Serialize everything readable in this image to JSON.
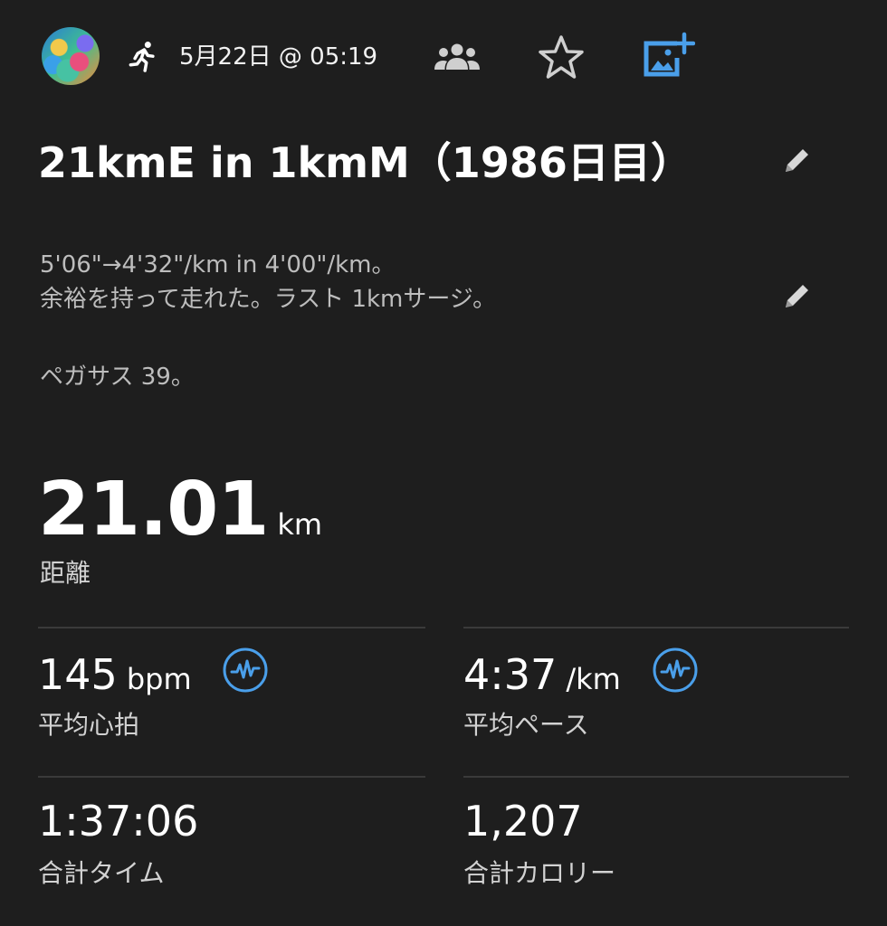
{
  "header": {
    "date_time": "5月22日 @ 05:19",
    "icons": {
      "activity": "running-icon",
      "group": "group-icon",
      "favorite": "star-icon",
      "add_photo": "add-photo-icon"
    },
    "accent_color": "#4a9fea"
  },
  "activity": {
    "title": "21kmE in 1kmM（1986日目）",
    "description_lines": [
      "5'06\"→4'32\"/km in 4'00\"/km。",
      "余裕を持って走れた。ラスト 1kmサージ。"
    ],
    "description_note": "ペガサス 39。"
  },
  "distance": {
    "value": "21.01",
    "unit": "km",
    "label": "距離"
  },
  "stats": {
    "avg_hr": {
      "value": "145",
      "unit": "bpm",
      "label": "平均心拍"
    },
    "avg_pace": {
      "value": "4:37",
      "unit": "/km",
      "label": "平均ペース"
    },
    "total_time": {
      "value": "1:37:06",
      "label": "合計タイム"
    },
    "total_calories": {
      "value": "1,207",
      "label": "合計カロリー"
    }
  }
}
